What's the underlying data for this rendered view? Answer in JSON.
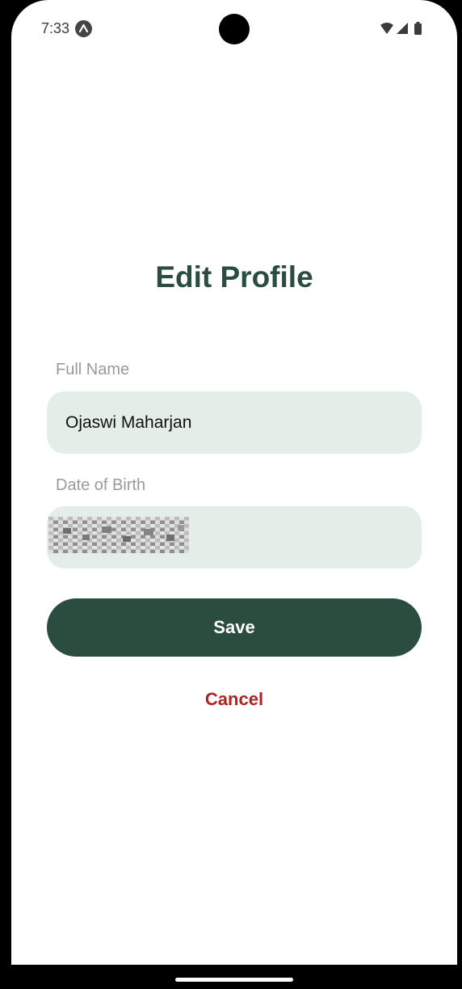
{
  "status_bar": {
    "time": "7:33",
    "app_icon": "android-head-icon",
    "icons": [
      "wifi-icon",
      "signal-icon",
      "battery-icon"
    ]
  },
  "form": {
    "title": "Edit Profile",
    "full_name": {
      "label": "Full Name",
      "value": "Ojaswi Maharjan"
    },
    "date_of_birth": {
      "label": "Date of Birth",
      "value": ""
    },
    "save_label": "Save",
    "cancel_label": "Cancel"
  },
  "colors": {
    "primary": "#2a4d40",
    "field_background": "#e3eee8",
    "cancel": "#b22222",
    "label": "#9a9a9a"
  }
}
